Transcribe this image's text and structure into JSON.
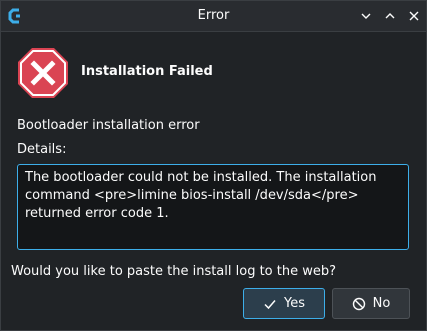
{
  "window": {
    "title": "Error",
    "app_icon": "calamares-icon",
    "controls": [
      "chevron-down-icon",
      "chevron-up-icon",
      "close-icon"
    ]
  },
  "dialog": {
    "icon": "error-stop-icon",
    "heading": "Installation Failed",
    "message": "Bootloader installation error",
    "details_label": "Details:",
    "details_text": "The bootloader could not be installed. The installation command <pre>limine bios-install /dev/sda</pre> returned error code 1.",
    "question": "Would you like to paste the install log to the web?"
  },
  "buttons": {
    "yes_label": "Yes",
    "yes_icon": "check-icon",
    "no_label": "No",
    "no_icon": "no-entry-icon"
  },
  "colors": {
    "accent": "#3daee9",
    "error_red": "#da4453",
    "background": "#202326"
  }
}
